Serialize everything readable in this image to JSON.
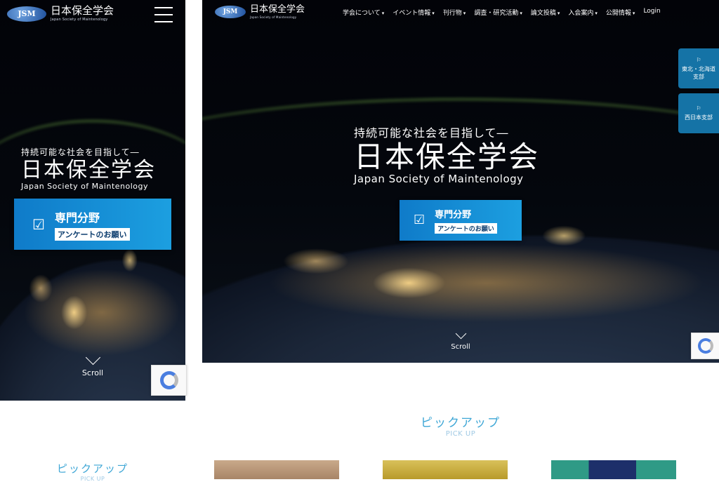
{
  "site": {
    "logo_abbr": "JSM",
    "logo_title": "日本保全学会",
    "logo_subtitle": "Japan Society of Maintenology"
  },
  "nav": {
    "items": [
      {
        "label": "学会について"
      },
      {
        "label": "イベント情報"
      },
      {
        "label": "刊行物"
      },
      {
        "label": "調査・研究活動"
      },
      {
        "label": "論文投稿"
      },
      {
        "label": "入会案内"
      },
      {
        "label": "公開情報"
      }
    ],
    "login": "Login"
  },
  "hero": {
    "subtitle": "持続可能な社会を目指して―",
    "title": "日本保全学会",
    "title_en": "Japan Society of Maintenology",
    "survey_main": "専門分野",
    "survey_sub": "アンケートのお願い",
    "scroll": "Scroll"
  },
  "side_tabs": [
    {
      "label_line1": "東北・北海道",
      "label_line2": "支部",
      "icon": "flag-icon"
    },
    {
      "label_line1": "西日本支部",
      "label_line2": "",
      "icon": "flag-icon"
    }
  ],
  "pickup": {
    "title": "ピックアップ",
    "subtitle": "PICK UP"
  },
  "colors": {
    "accent": "#3fa7d6",
    "survey_blue": "#1c9fe0",
    "side_tab": "#1573a6"
  }
}
